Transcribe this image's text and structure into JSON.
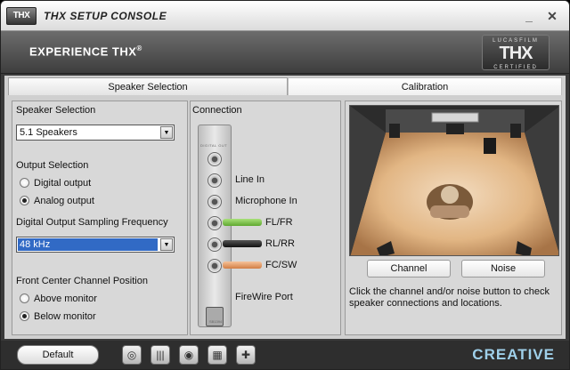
{
  "window": {
    "title": "THX SETUP CONSOLE",
    "logo_text": "THX",
    "minimize_glyph": "_",
    "close_glyph": "✕"
  },
  "banner": {
    "heading": "EXPERIENCE THX",
    "heading_mark": "®",
    "logo_top": "LUCASFILM",
    "logo_main": "THX",
    "logo_bottom": "CERTIFIED"
  },
  "tabs": [
    {
      "label": "Speaker Selection",
      "active": true
    },
    {
      "label": "Calibration",
      "active": false
    }
  ],
  "speaker_panel": {
    "speaker_selection_label": "Speaker Selection",
    "speaker_selection_value": "5.1 Speakers",
    "output_selection_label": "Output Selection",
    "output_options": [
      {
        "label": "Digital output",
        "selected": false
      },
      {
        "label": "Analog output",
        "selected": true
      }
    ],
    "sampling_label": "Digital Output Sampling Frequency",
    "sampling_value": "48 kHz",
    "front_center_label": "Front Center Channel Position",
    "front_center_options": [
      {
        "label": "Above monitor",
        "selected": false
      },
      {
        "label": "Below monitor",
        "selected": true
      }
    ]
  },
  "connection_panel": {
    "heading": "Connection",
    "card_top_label": "DIGITAL OUT",
    "card_serial": "SB1394",
    "ports": [
      {
        "label": "Line In",
        "plug_color": ""
      },
      {
        "label": "Microphone In",
        "plug_color": ""
      },
      {
        "label": "FL/FR",
        "plug_color": "#7cc444"
      },
      {
        "label": "RL/RR",
        "plug_color": "#222222"
      },
      {
        "label": "FC/SW",
        "plug_color": "#e69a62"
      },
      {
        "label": "FireWire Port",
        "plug_color": ""
      }
    ]
  },
  "calibration_panel": {
    "channel_button": "Channel",
    "noise_button": "Noise",
    "hint": "Click the channel and/or noise button to check speaker connections and locations."
  },
  "bottom_bar": {
    "default_button": "Default",
    "tools": [
      {
        "icon": "speaker-disc-icon"
      },
      {
        "icon": "equalizer-icon"
      },
      {
        "icon": "speaker-round-icon"
      },
      {
        "icon": "mixer-icon"
      },
      {
        "icon": "speaker-plus-icon"
      }
    ],
    "brand": "CREATIVE"
  },
  "colors": {
    "selection_blue": "#316ac5",
    "front_plug_green": "#7cc444",
    "sw_plug_orange": "#e69a62",
    "brand_blue": "#9fd0ea"
  }
}
